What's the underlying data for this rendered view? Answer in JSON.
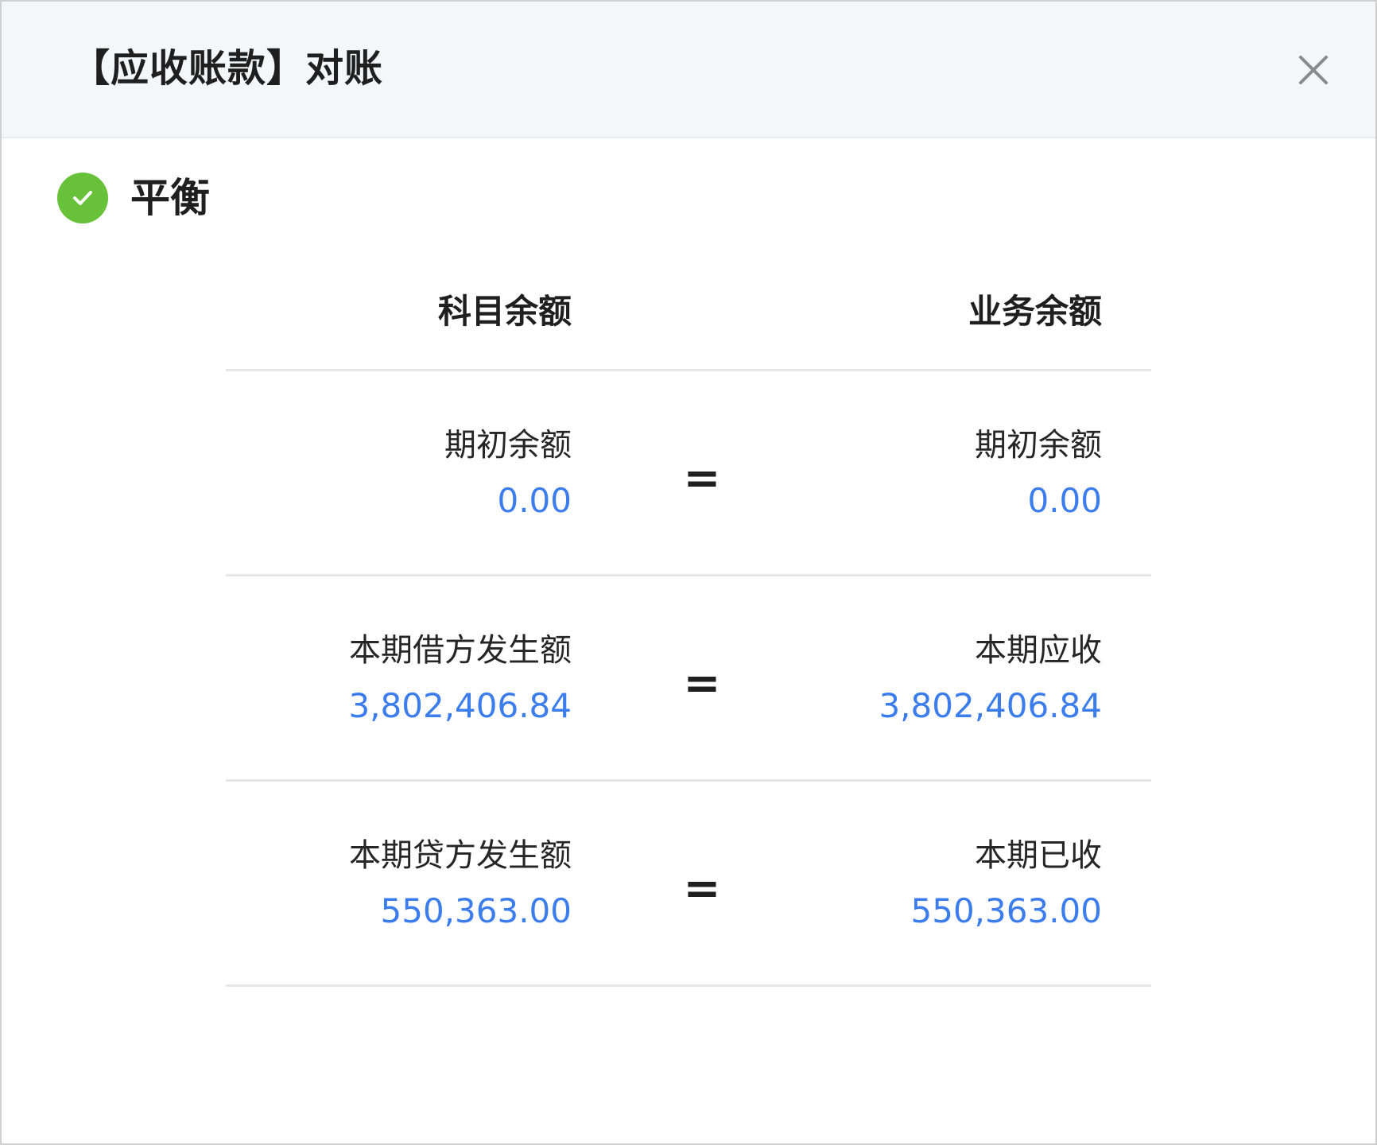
{
  "dialog": {
    "title": "【应收账款】对账",
    "close_icon": "close-icon"
  },
  "status": {
    "icon": "check-circle-icon",
    "icon_color": "#67c23a",
    "text": "平衡"
  },
  "columns": {
    "left": "科目余额",
    "right": "业务余额"
  },
  "rows": [
    {
      "left_label": "期初余额",
      "left_value": "0.00",
      "operator": "=",
      "right_label": "期初余额",
      "right_value": "0.00"
    },
    {
      "left_label": "本期借方发生额",
      "left_value": "3,802,406.84",
      "operator": "=",
      "right_label": "本期应收",
      "right_value": "3,802,406.84"
    },
    {
      "left_label": "本期贷方发生额",
      "left_value": "550,363.00",
      "operator": "=",
      "right_label": "本期已收",
      "right_value": "550,363.00"
    }
  ],
  "colors": {
    "value": "#3b7ded",
    "header_bg": "#f5f6f8"
  }
}
